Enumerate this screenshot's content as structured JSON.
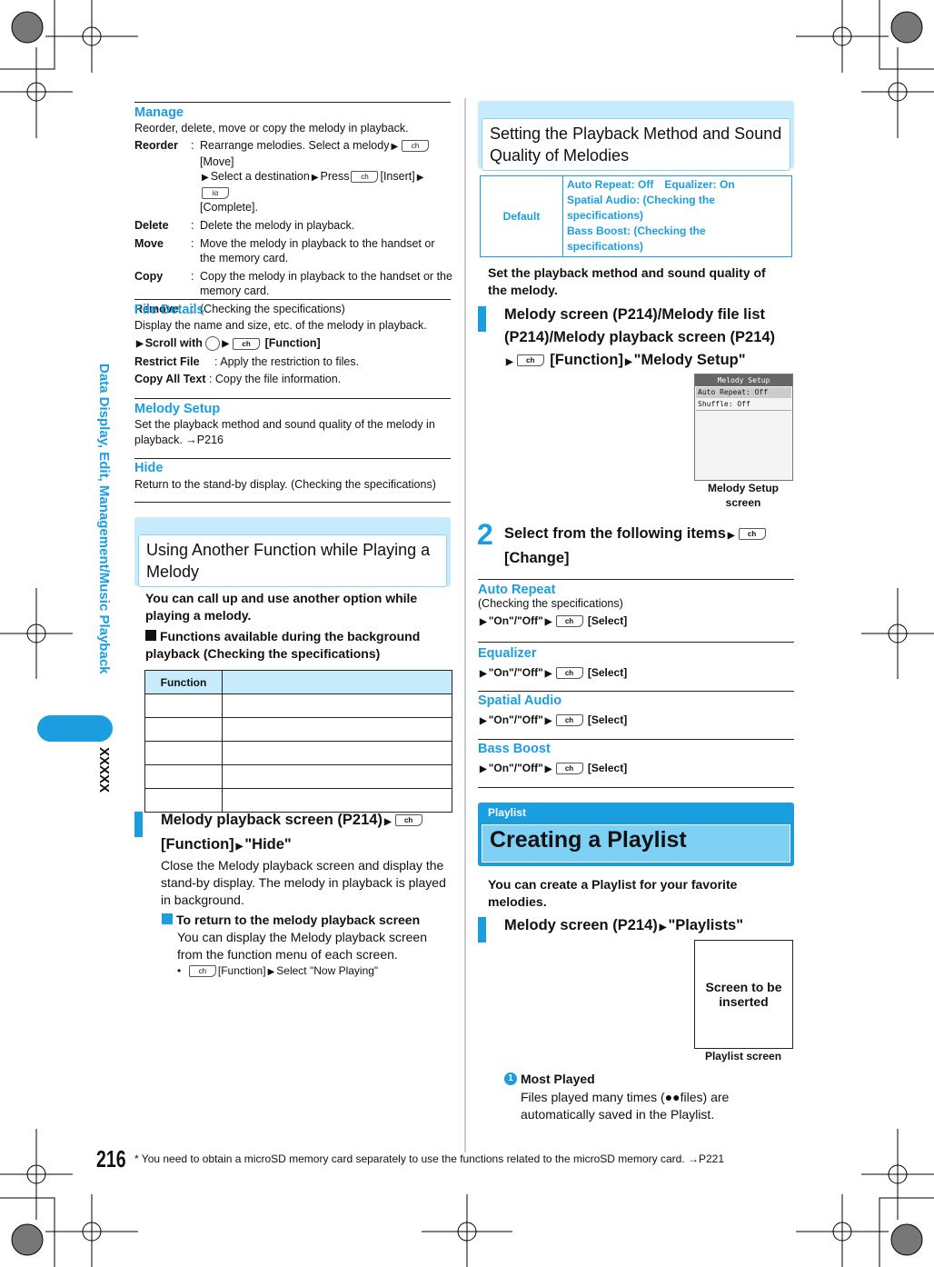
{
  "side": {
    "chapter": "Data Display, Edit, Management/Music Playback",
    "tag": "XXXXX",
    "page_number": "216"
  },
  "footnote": "* You need to obtain a microSD memory card separately to use the functions related to the microSD memory card. →P221",
  "keys": {
    "center": "ch",
    "i": "iα"
  },
  "arrow": "▶",
  "manage": {
    "title": "Manage",
    "desc": "Reorder, delete, move or copy the melody in playback.",
    "reorder_t": "Reorder",
    "reorder_1": "Rearrange melodies. Select a melody",
    "reorder_2": "[Move]",
    "reorder_3": "Select a destination",
    "reorder_4": "Press",
    "reorder_5": "[Insert]",
    "reorder_6": "[Complete].",
    "delete_t": "Delete",
    "delete_d": "Delete the melody in playback.",
    "move_t": "Move",
    "move_d": "Move the melody in playback to the handset or the memory card.",
    "copy_t": "Copy",
    "copy_d": "Copy the melody in playback to the handset or the memory card.",
    "remove_t": "Remove",
    "remove_d": "(Checking the specifications)"
  },
  "file": {
    "title": "File Details",
    "desc": "Display the name and size, etc. of the melody in playback.",
    "scroll": "Scroll with",
    "fn": "[Function]",
    "restrict_t": "Restrict File",
    "restrict_d": "Apply the restriction to files.",
    "copyall_t": "Copy All Text",
    "copyall_d": "Copy the file information."
  },
  "setup": {
    "title": "Melody Setup",
    "desc": "Set the playback method and sound quality of the melody in playback. →P216"
  },
  "hide": {
    "title": "Hide",
    "desc": "Return to the stand-by display. (Checking the specifications)"
  },
  "another": {
    "title": "Using Another Function while Playing a Melody",
    "intro": "You can call up and use another option while playing a melody.",
    "functions": "Functions available during the background playback (Checking the specifications)",
    "col": "Function",
    "step1a": "Melody playback screen (P214)",
    "step1b": "[Function]",
    "step1c": "\"Hide\"",
    "step1_desc": "Close the Melody playback screen and display the stand-by display. The melody in playback is played in background.",
    "return_t": "To return to the melody playback screen",
    "return_d": "You can display the Melody playback screen from the function menu of each screen.",
    "bullet1": "[Function]",
    "bullet2": "Select \"Now Playing\""
  },
  "playback": {
    "title": "Setting the Playback Method and Sound Quality of Melodies",
    "default_label": "Default",
    "defaults": [
      "Auto Repeat: Off Equalizer: On",
      "Spatial Audio: (Checking the specifications)",
      "Bass Boost: (Checking the specifications)"
    ],
    "intro": "Set the playback method and sound quality of the melody.",
    "step1a": "Melody screen (P214)/Melody file list (P214)/Melody playback screen (P214)",
    "step1b": "[Function]",
    "step1c": "\"Melody Setup\"",
    "screen": {
      "title": "Melody Setup",
      "items": [
        "Auto Repeat: Off",
        "Shuffle: Off"
      ],
      "caption": "Melody Setup screen"
    },
    "step2a": "Select from the following items",
    "step2b": "[Change]",
    "items": [
      {
        "title": "Auto Repeat",
        "note": "(Checking the specifications)",
        "opt": "\"On\"/\"Off\"",
        "act": "[Select]"
      },
      {
        "title": "Equalizer",
        "opt": "\"On\"/\"Off\"",
        "act": "[Select]"
      },
      {
        "title": "Spatial Audio",
        "opt": "\"On\"/\"Off\"",
        "act": "[Select]"
      },
      {
        "title": "Bass Boost",
        "opt": "\"On\"/\"Off\"",
        "act": "[Select]"
      }
    ]
  },
  "playlist": {
    "tab": "Playlist",
    "title": "Creating a Playlist",
    "intro": "You can create a Playlist for your favorite melodies.",
    "step1a": "Melody screen (P214)",
    "step1c": "\"Playlists\"",
    "placeholder": "Screen to be inserted",
    "caption": "Playlist screen",
    "num": "1",
    "most_t": "Most Played",
    "most_d": "Files played many times (●●files) are automatically saved in the Playlist."
  },
  "colors": {
    "accent": "#1a9ee0",
    "band": "#c6ebfb"
  }
}
